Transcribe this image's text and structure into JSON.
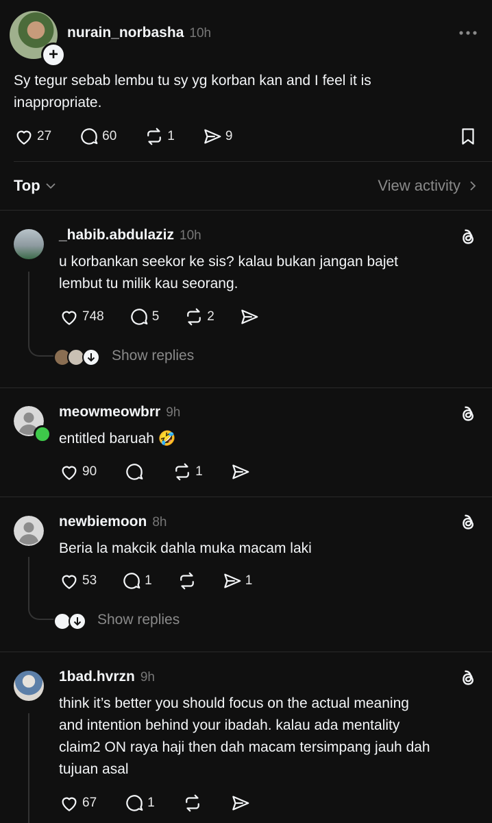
{
  "post": {
    "username": "nurain_norbasha",
    "time": "10h",
    "text_line1": "Sy tegur sebab lembu tu sy yg korban kan and I feel it is",
    "text_line2": "inappropriate.",
    "likes": "27",
    "comments": "60",
    "reposts": "1",
    "shares": "9"
  },
  "sort": {
    "label": "Top",
    "view_activity": "View activity"
  },
  "replies": [
    {
      "username": "_habib.abdulaziz",
      "time": "10h",
      "line1": "u korbankan seekor ke sis? kalau bukan jangan bajet",
      "line2": "lembut tu milik kau seorang.",
      "likes": "748",
      "comments": "5",
      "reposts": "2",
      "show_replies": "Show replies"
    },
    {
      "username": "meowmeowbrr",
      "time": "9h",
      "line1": "entitled baruah 🤣",
      "likes": "90",
      "reposts": "1"
    },
    {
      "username": "newbiemoon",
      "time": "8h",
      "line1": "Beria la makcik dahla muka macam laki",
      "likes": "53",
      "comments": "1",
      "shares": "1",
      "show_replies": "Show replies"
    },
    {
      "username": "1bad.hvrzn",
      "time": "9h",
      "line1": "think it’s better you should focus on the actual meaning",
      "line2": "and intention behind your ibadah. kalau ada mentality",
      "line3": "claim2 ON raya haji then dah macam tersimpang jauh dah",
      "line4": "tujuan asal",
      "likes": "67",
      "comments": "1"
    }
  ],
  "icons": [
    "heart-icon",
    "comment-icon",
    "repost-icon",
    "share-icon",
    "bookmark-icon",
    "threads-icon",
    "more-icon",
    "chevron-right-icon",
    "chevron-down-icon",
    "follow-plus-icon"
  ],
  "colors": {
    "background": "#101010",
    "text": "#f3f5f7",
    "muted": "#777777",
    "online": "#3ec94a"
  }
}
